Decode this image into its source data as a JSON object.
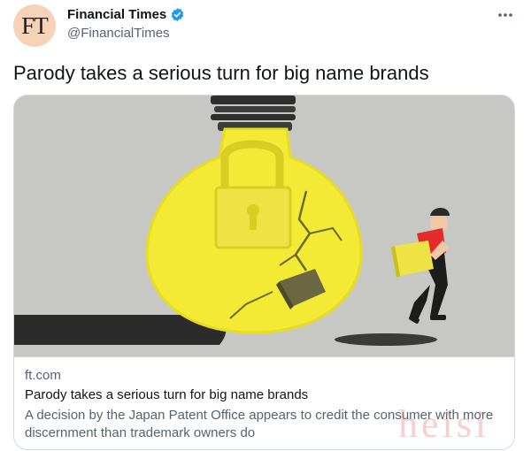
{
  "tweet": {
    "avatar_text": "FT",
    "display_name": "Financial Times",
    "handle": "@FinancialTimes",
    "verified_icon": "verified-badge-icon",
    "more_icon": "more-options-icon",
    "text": "Parody takes a serious turn for big name brands"
  },
  "card": {
    "image_icon": "lightbulb-padlock-illustration",
    "domain": "ft.com",
    "title": "Parody takes a serious turn for big name brands",
    "description": "A decision by the Japan Patent Office appears to credit the consumer with more discernment than trademark owners do"
  },
  "watermark": "heisi",
  "colors": {
    "verified_blue": "#1d9bf0",
    "bulb_yellow": "#f3ea35",
    "image_background": "#c5c6c2",
    "secondary_text": "#536471"
  }
}
